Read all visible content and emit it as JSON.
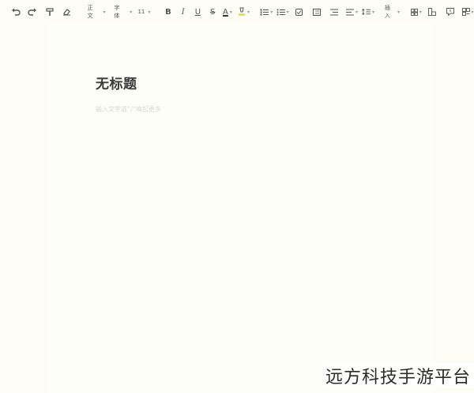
{
  "toolbar": {
    "paragraph_style": "正文",
    "font_family": "字体",
    "font_size": "11",
    "insert_label": "插入",
    "bold": "B",
    "italic": "I",
    "underline": "U",
    "strike": "S",
    "font_color": "A"
  },
  "document": {
    "title": "无标题",
    "body_placeholder": "输入文字或“/”唤起更多"
  },
  "watermark": "远方科技手游平台",
  "colors": {
    "background": "#fdfdf6",
    "text": "#3a3a3a",
    "placeholder": "#d8d8d4",
    "highlight": "#f2d94e"
  }
}
